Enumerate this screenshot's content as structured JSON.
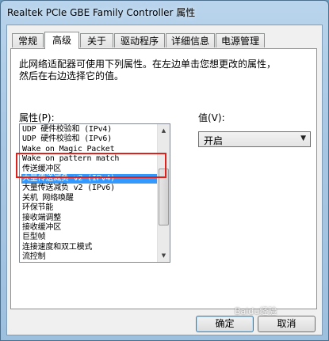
{
  "window": {
    "title": "Realtek PCIe GBE Family Controller 属性"
  },
  "tabs": [
    {
      "label": "常规"
    },
    {
      "label": "高级"
    },
    {
      "label": "关于"
    },
    {
      "label": "驱动程序"
    },
    {
      "label": "详细信息"
    },
    {
      "label": "电源管理"
    }
  ],
  "active_tab": "高级",
  "panel": {
    "description_line1": "此网络适配器可使用下列属性。在左边单击您想更改的属性，",
    "description_line2": "然后在右边选择它的值。",
    "property_label": "属性(P):",
    "value_label": "值(V):"
  },
  "properties": [
    "UDP 硬件校验和 (IPv4)",
    "UDP 硬件校验和 (IPv6)",
    "Wake on Magic Packet",
    "Wake on pattern match",
    "传送缓冲区",
    "大量传送减负 v2 (IPv4)",
    "大量传送减负 v2 (IPv6)",
    "关机 网络唤醒",
    "环保节能",
    "接收端调整",
    "接收缓冲区",
    "巨型帧",
    "连接速度和双工模式",
    "流控制"
  ],
  "selected_property": "大量传送减负 v2 (IPv4)",
  "value_dropdown": {
    "selected": "开启"
  },
  "buttons": {
    "ok": "确定",
    "cancel": "取消"
  },
  "watermark": "Baidu经验",
  "colors": {
    "selection": "#3399ff",
    "annotation_box": "#e0201b"
  }
}
